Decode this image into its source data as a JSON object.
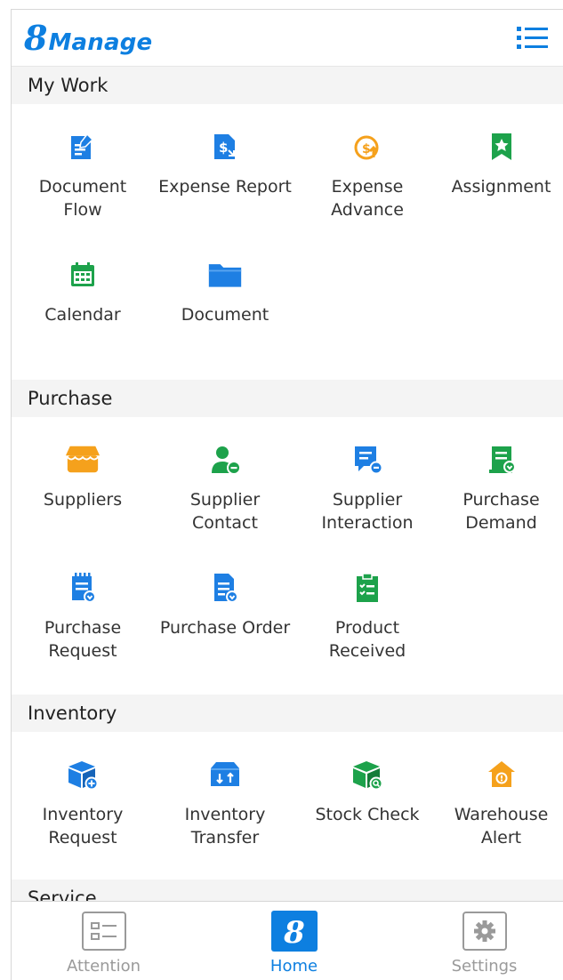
{
  "app": {
    "logo_numeral": "8",
    "logo_text": "Manage"
  },
  "header": {
    "menu_icon": "list-menu-icon"
  },
  "sections": [
    {
      "title": "My Work",
      "items": [
        {
          "label": "Document\nFlow",
          "icon": "document-flow-icon",
          "color": "#1e7fe3"
        },
        {
          "label": "Expense Report",
          "icon": "expense-report-icon",
          "color": "#1e7fe3"
        },
        {
          "label": "Expense\nAdvance",
          "icon": "expense-advance-icon",
          "color": "#f5a11c"
        },
        {
          "label": "Assignment",
          "icon": "assignment-icon",
          "color": "#1da24b"
        },
        {
          "label": "Calendar",
          "icon": "calendar-icon",
          "color": "#1da24b"
        },
        {
          "label": "Document",
          "icon": "folder-icon",
          "color": "#1e7fe3"
        }
      ]
    },
    {
      "title": "Purchase",
      "items": [
        {
          "label": "Suppliers",
          "icon": "store-icon",
          "color": "#f5a11c"
        },
        {
          "label": "Supplier\nContact",
          "icon": "supplier-contact-icon",
          "color": "#1da24b"
        },
        {
          "label": "Supplier\nInteraction",
          "icon": "supplier-interaction-icon",
          "color": "#1e7fe3"
        },
        {
          "label": "Purchase\nDemand",
          "icon": "purchase-demand-icon",
          "color": "#1da24b"
        },
        {
          "label": "Purchase\nRequest",
          "icon": "purchase-request-icon",
          "color": "#1e7fe3"
        },
        {
          "label": "Purchase Order",
          "icon": "purchase-order-icon",
          "color": "#1e7fe3"
        },
        {
          "label": "Product\nReceived",
          "icon": "product-received-icon",
          "color": "#1da24b"
        }
      ]
    },
    {
      "title": "Inventory",
      "items": [
        {
          "label": "Inventory\nRequest",
          "icon": "inventory-request-icon",
          "color": "#1e7fe3"
        },
        {
          "label": "Inventory\nTransfer",
          "icon": "inventory-transfer-icon",
          "color": "#1e7fe3"
        },
        {
          "label": "Stock Check",
          "icon": "stock-check-icon",
          "color": "#1da24b"
        },
        {
          "label": "Warehouse\nAlert",
          "icon": "warehouse-alert-icon",
          "color": "#f5a11c"
        }
      ]
    },
    {
      "title": "Service",
      "items": []
    }
  ],
  "bottom_nav": [
    {
      "label": "Attention",
      "icon": "attention-list-icon",
      "active": false
    },
    {
      "label": "Home",
      "icon": "home-8-icon",
      "active": true
    },
    {
      "label": "Settings",
      "icon": "settings-gear-icon",
      "active": false
    }
  ],
  "colors": {
    "accent": "#0d7fe0",
    "blue": "#1e7fe3",
    "green": "#1da24b",
    "orange": "#f5a11c",
    "inactive": "#9a9a9a"
  }
}
